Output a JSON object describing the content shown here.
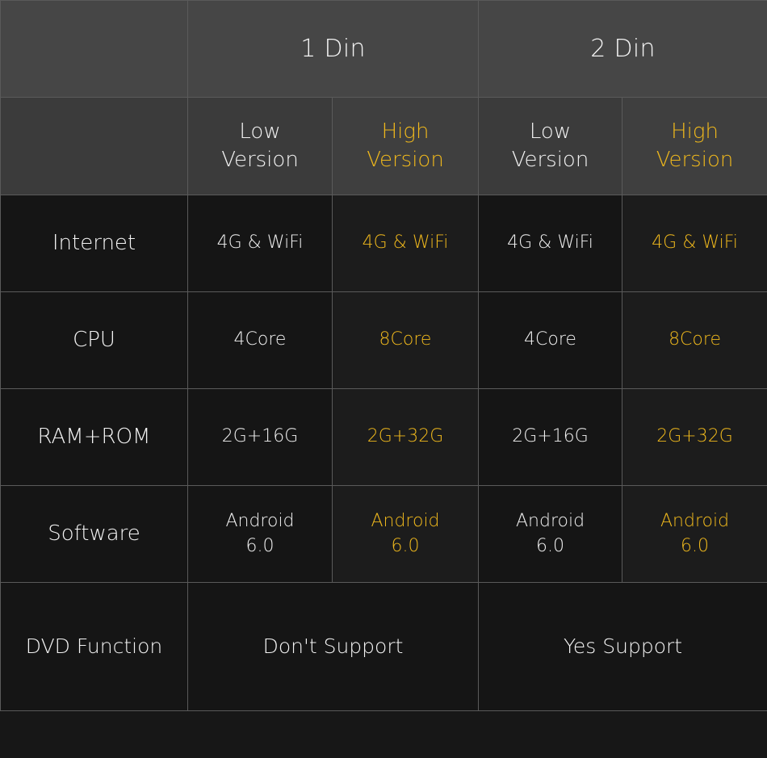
{
  "table": {
    "accent_color": "#efb81c",
    "text_color": "#f2f2f2",
    "header_bg": "#464646",
    "subheader_bg": "#3b3b3b",
    "body_bg": "#151515",
    "border_color": "#5a5a5a",
    "corner_label": "",
    "groups": [
      {
        "label": "1 Din"
      },
      {
        "label": "2 Din"
      }
    ],
    "version_columns": [
      {
        "line1": "Low",
        "line2": "Version",
        "accent": false
      },
      {
        "line1": "High",
        "line2": "Version",
        "accent": true
      },
      {
        "line1": "Low",
        "line2": "Version",
        "accent": false
      },
      {
        "line1": "High",
        "line2": "Version",
        "accent": true
      }
    ],
    "rows": [
      {
        "feature": "Internet",
        "values": [
          {
            "line1": "4G & WiFi",
            "line2": ""
          },
          {
            "line1": "4G & WiFi",
            "line2": ""
          },
          {
            "line1": "4G & WiFi",
            "line2": ""
          },
          {
            "line1": "4G & WiFi",
            "line2": ""
          }
        ]
      },
      {
        "feature": "CPU",
        "values": [
          {
            "line1": "4Core",
            "line2": ""
          },
          {
            "line1": "8Core",
            "line2": ""
          },
          {
            "line1": "4Core",
            "line2": ""
          },
          {
            "line1": "8Core",
            "line2": ""
          }
        ]
      },
      {
        "feature": "RAM+ROM",
        "values": [
          {
            "line1": "2G+16G",
            "line2": ""
          },
          {
            "line1": "2G+32G",
            "line2": ""
          },
          {
            "line1": "2G+16G",
            "line2": ""
          },
          {
            "line1": "2G+32G",
            "line2": ""
          }
        ]
      },
      {
        "feature": "Software",
        "values": [
          {
            "line1": "Android",
            "line2": "6.0"
          },
          {
            "line1": "Android",
            "line2": "6.0"
          },
          {
            "line1": "Android",
            "line2": "6.0"
          },
          {
            "line1": "Android",
            "line2": "6.0"
          }
        ]
      }
    ],
    "merged_row": {
      "feature": "DVD Function",
      "values": [
        {
          "label": "Don't Support"
        },
        {
          "label": "Yes Support"
        }
      ]
    }
  }
}
